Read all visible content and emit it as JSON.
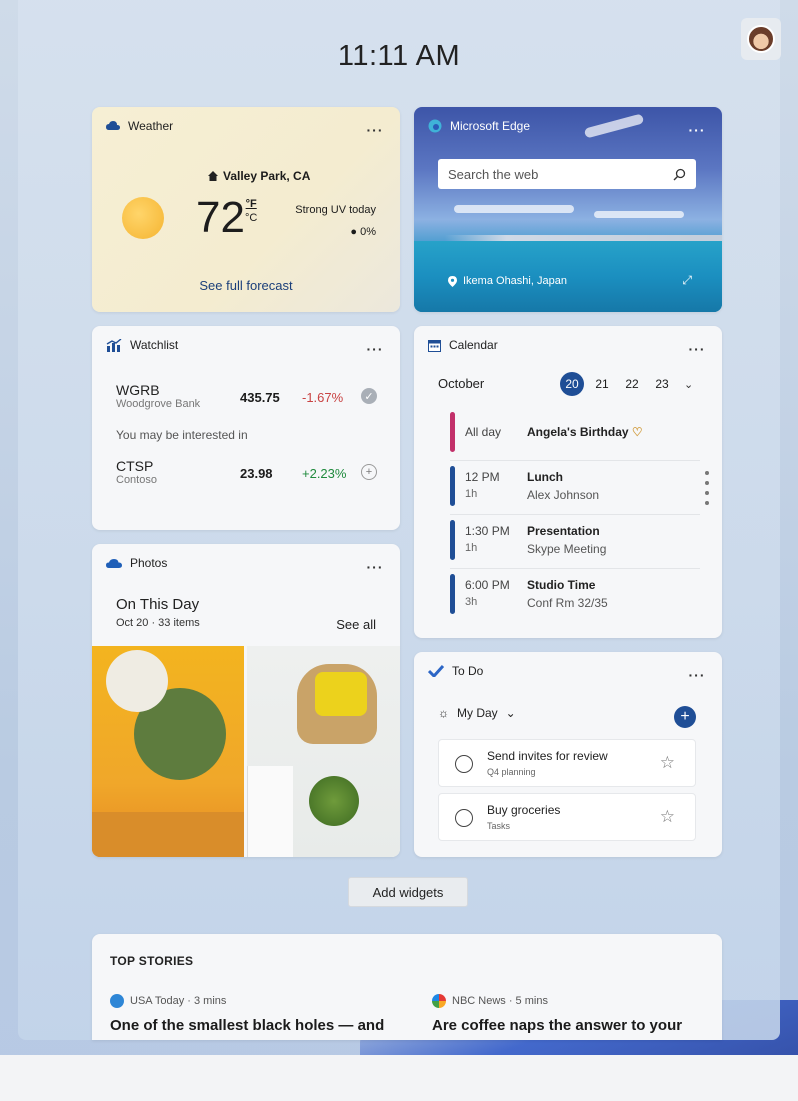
{
  "time": "11:11 AM",
  "weather": {
    "title": "Weather",
    "location": "Valley Park, CA",
    "temperature": "72",
    "unit_f": "°F",
    "unit_c": "°C",
    "condition": "Strong UV today",
    "precip": "0%",
    "link": "See full forecast"
  },
  "edge": {
    "title": "Microsoft Edge",
    "search_placeholder": "Search the web",
    "location": "Ikema Ohashi, Japan"
  },
  "watchlist": {
    "title": "Watchlist",
    "stocks": [
      {
        "symbol": "WGRB",
        "name": "Woodgrove Bank",
        "price": "435.75",
        "change": "-1.67%"
      },
      {
        "symbol": "CTSP",
        "name": "Contoso",
        "price": "23.98",
        "change": "+2.23%"
      }
    ],
    "interest_label": "You may be interested in"
  },
  "calendar": {
    "title": "Calendar",
    "month": "October",
    "days": [
      "20",
      "21",
      "22",
      "23"
    ],
    "selected_day": "20",
    "events": [
      {
        "time": "All day",
        "duration": "",
        "title": "Angela's Birthday",
        "subtitle": "",
        "color": "#c2306a"
      },
      {
        "time": "12 PM",
        "duration": "1h",
        "title": "Lunch",
        "subtitle": "Alex Johnson",
        "color": "#1f4e96"
      },
      {
        "time": "1:30 PM",
        "duration": "1h",
        "title": "Presentation",
        "subtitle": "Skype Meeting",
        "color": "#1f4e96"
      },
      {
        "time": "6:00 PM",
        "duration": "3h",
        "title": "Studio Time",
        "subtitle": "Conf Rm 32/35",
        "color": "#1f4e96"
      }
    ]
  },
  "photos": {
    "title": "Photos",
    "heading": "On This Day",
    "subtitle": "Oct 20 · 33 items",
    "see_all": "See all"
  },
  "todo": {
    "title": "To Do",
    "list_name": "My Day",
    "tasks": [
      {
        "name": "Send invites for review",
        "list": "Q4 planning"
      },
      {
        "name": "Buy groceries",
        "list": "Tasks"
      }
    ]
  },
  "add_widgets": "Add widgets",
  "top_stories": {
    "title": "TOP STORIES",
    "stories": [
      {
        "source": "USA Today · 3 mins",
        "headline": "One of the smallest black holes — and"
      },
      {
        "source": "NBC News · 5 mins",
        "headline": "Are coffee naps the answer to your"
      }
    ]
  },
  "colors": {
    "accent": "#1f4e96",
    "negative": "#c94343",
    "positive": "#1f8a3d",
    "birthday": "#c2306a"
  }
}
